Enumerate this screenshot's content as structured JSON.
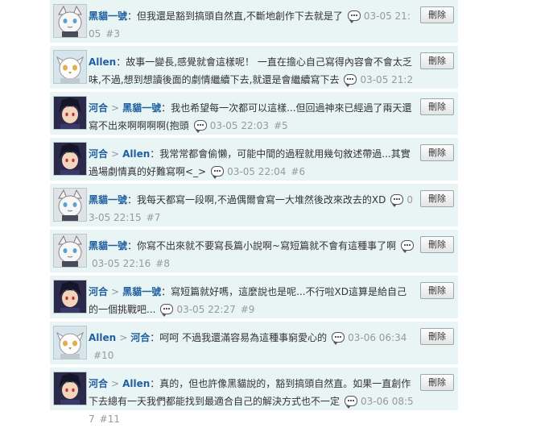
{
  "delete_label": "刪除",
  "colors": {
    "row_bg": "#e9f4f4",
    "name": "#1f5f9f",
    "meta": "#999999"
  },
  "comments": [
    {
      "avatar": "white-cat",
      "author": "黑貓一號",
      "reply_to": "",
      "text": "但我還是豁到搞頭自然直,不斷地創作下去就是了",
      "time": "03-05 21:05",
      "num": "#3"
    },
    {
      "avatar": "white-owl",
      "author": "Allen",
      "reply_to": "",
      "text": "故事一變長,感覺就會這樣呢！ 一直在擔心自己寫得內容會不會太乏味,不過,想到想讀後面的劇情繼續下去,就還是會繼續寫下去",
      "time": "03-05 21:22",
      "num": "#4"
    },
    {
      "avatar": "dark-hair",
      "author": "河合",
      "reply_to": "黑貓一號",
      "text": "我也希望每一次都可以這樣...但回過神來已經過了兩天還寫不出來啊啊啊啊(抱頭",
      "time": "03-05 22:03",
      "num": "#5"
    },
    {
      "avatar": "dark-hair",
      "author": "河合",
      "reply_to": "Allen",
      "text": "我常常都會偷懶，可能中間的過程就用幾句敘述帶過...其實過場劇情真的好難寫啊<_>",
      "time": "03-05 22:04",
      "num": "#6"
    },
    {
      "avatar": "white-cat",
      "author": "黑貓一號",
      "reply_to": "",
      "text": "我每天都寫一段啊,不過偶爾會寫一大堆然後改來改去的XD",
      "time": "03-05 22:15",
      "num": "#7"
    },
    {
      "avatar": "white-cat",
      "author": "黑貓一號",
      "reply_to": "",
      "text": "你寫不出來就不要寫長篇小說啊~寫短篇就不會有這種事了啊",
      "time": "03-05 22:16",
      "num": "#8"
    },
    {
      "avatar": "dark-hair",
      "author": "河合",
      "reply_to": "黑貓一號",
      "text": "寫短篇就好嗎，這麼說也是呢...不行啦XD這算是給自己的一個挑戰吧...",
      "time": "03-05 22:27",
      "num": "#9"
    },
    {
      "avatar": "white-owl",
      "author": "Allen",
      "reply_to": "河合",
      "text": "呵呵 不過我還滿容易為這種事窮愛心的",
      "time": "03-06 06:34",
      "num": "#10"
    },
    {
      "avatar": "dark-hair",
      "author": "河合",
      "reply_to": "Allen",
      "text": "真的，但也許像黑貓說的，豁到搞頭自然直。如果一直創作下去總有一天我們都能找到最適合自己的解決方式也不一定",
      "time": "03-06 08:57",
      "num": "#11"
    }
  ]
}
